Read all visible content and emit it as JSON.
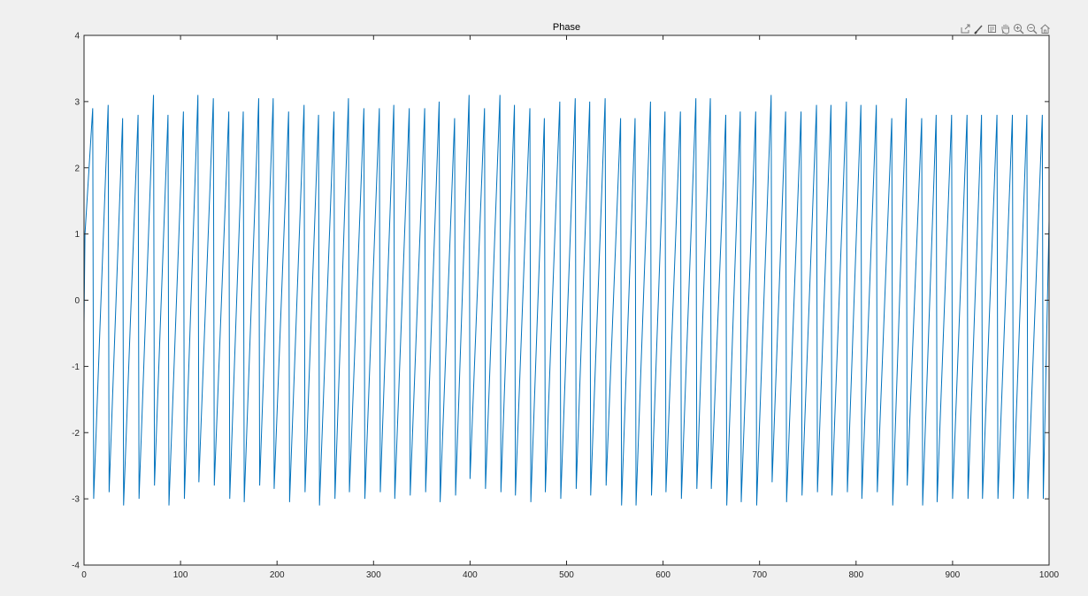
{
  "toolbar": {
    "items": [
      {
        "name": "export-icon"
      },
      {
        "name": "brush-icon"
      },
      {
        "name": "datatip-icon"
      },
      {
        "name": "pan-icon"
      },
      {
        "name": "zoom-in-icon"
      },
      {
        "name": "zoom-out-icon"
      },
      {
        "name": "home-icon"
      }
    ]
  },
  "colors": {
    "line": "#0072bd",
    "axes_bg": "#ffffff",
    "figure_bg": "#f0f0f0",
    "axis": "#262626"
  },
  "chart_data": {
    "type": "line",
    "title": "Phase",
    "xlabel": "",
    "ylabel": "",
    "xlim": [
      0,
      1000
    ],
    "ylim": [
      -4,
      4
    ],
    "x_ticks": [
      0,
      100,
      200,
      300,
      400,
      500,
      600,
      700,
      800,
      900,
      1000
    ],
    "y_ticks": [
      -4,
      -3,
      -2,
      -1,
      0,
      1,
      2,
      3,
      4
    ],
    "grid": false,
    "legend": "none",
    "series": [
      {
        "x": [
          0,
          1,
          9,
          10,
          25,
          26,
          40,
          41,
          56,
          57,
          72,
          73,
          87,
          88,
          103,
          104,
          118,
          119,
          134,
          135,
          150,
          151,
          165,
          166,
          181,
          182,
          196,
          197,
          212,
          213,
          228,
          229,
          243,
          244,
          259,
          260,
          274,
          275,
          290,
          291,
          306,
          307,
          321,
          322,
          337,
          338,
          353,
          354,
          368,
          369,
          384,
          385,
          399,
          400,
          415,
          416,
          431,
          432,
          446,
          447,
          462,
          463,
          477,
          478,
          493,
          494,
          509,
          510,
          524,
          525,
          540,
          541,
          556,
          557,
          571,
          572,
          587,
          588,
          602,
          603,
          618,
          619,
          634,
          635,
          649,
          650,
          665,
          666,
          680,
          681,
          696,
          697,
          712,
          713,
          727,
          728,
          743,
          744,
          759,
          760,
          774,
          775,
          790,
          791,
          805,
          806,
          821,
          822,
          837,
          838,
          852,
          853,
          868,
          869,
          883,
          884,
          899,
          900,
          915,
          916,
          930,
          931,
          946,
          947,
          962,
          963,
          977,
          978,
          993,
          994,
          1000
        ],
        "y": [
          -0.35,
          1.0,
          2.9,
          -3.0,
          2.95,
          -2.9,
          2.75,
          -3.1,
          2.8,
          -3.0,
          3.1,
          -2.8,
          2.8,
          -3.1,
          2.85,
          -3.0,
          3.1,
          -2.75,
          3.05,
          -2.8,
          2.85,
          -3.0,
          2.85,
          -3.05,
          3.05,
          -2.8,
          3.05,
          -2.85,
          2.85,
          -3.05,
          2.95,
          -2.9,
          2.8,
          -3.1,
          2.85,
          -3.0,
          3.05,
          -2.9,
          2.9,
          -3.0,
          2.9,
          -2.9,
          2.95,
          -3.0,
          2.9,
          -2.95,
          2.9,
          -2.9,
          3.0,
          -3.05,
          2.75,
          -2.95,
          3.1,
          -2.7,
          2.9,
          -2.85,
          3.1,
          -2.9,
          2.95,
          -2.95,
          2.9,
          -3.05,
          2.75,
          -2.9,
          3.0,
          -3.0,
          3.05,
          -2.85,
          3.0,
          -2.95,
          3.05,
          -2.8,
          2.75,
          -3.1,
          2.75,
          -3.1,
          3.0,
          -2.95,
          2.85,
          -2.9,
          2.85,
          -3.0,
          3.05,
          -2.85,
          3.05,
          -2.85,
          2.8,
          -3.1,
          2.85,
          -3.05,
          2.85,
          -3.1,
          3.1,
          -2.75,
          2.85,
          -3.05,
          2.85,
          -2.95,
          2.95,
          -2.9,
          2.95,
          -2.95,
          3.0,
          -2.9,
          2.95,
          -3.0,
          2.95,
          -2.9,
          2.75,
          -3.1,
          3.05,
          -2.8,
          2.75,
          -3.1,
          2.8,
          -3.05,
          2.8,
          -3.0,
          2.8,
          -3.0,
          2.8,
          -3.0,
          2.8,
          -3.0,
          2.8,
          -3.0,
          2.8,
          -3.0,
          2.8,
          -3.0,
          1.2
        ]
      }
    ]
  }
}
